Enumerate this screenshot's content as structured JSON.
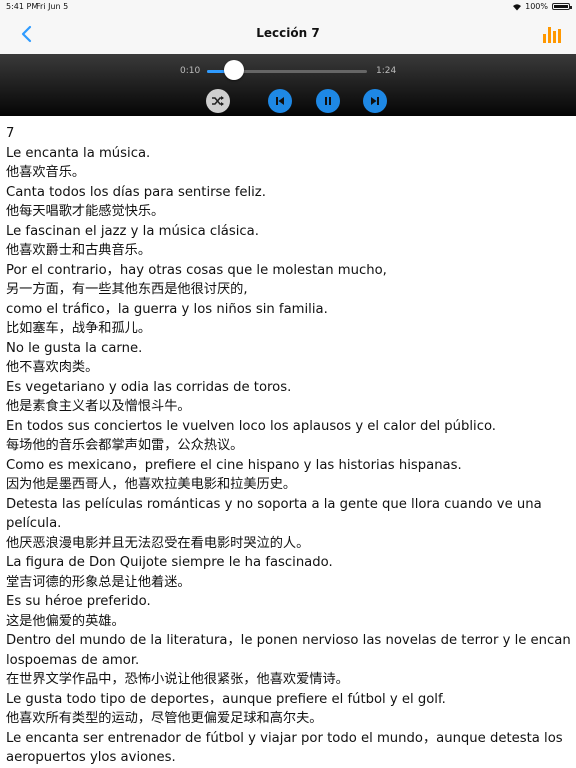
{
  "status_bar": {
    "time": "5:41 PM",
    "date": "Fri Jun 5",
    "battery": "100%",
    "battery_level": 1.0
  },
  "nav": {
    "title": "Lección 7",
    "back_icon": "chevron-left-icon",
    "stats_icon": "bar-chart-icon",
    "accent": "#2f9bff",
    "stats_color": "#ff9800"
  },
  "player": {
    "current_time": "0:10",
    "total_time": "1:24",
    "progress_fraction": 0.12,
    "controls": [
      "shuffle-icon",
      "skip-back-icon",
      "pause-icon",
      "skip-forward-icon"
    ]
  },
  "lines": [
    "7",
    "Le encanta la música.",
    "他喜欢音乐。",
    "Canta todos los días para sentirse feliz.",
    "他每天唱歌才能感觉快乐。",
    "Le fascinan el jazz y la música clásica.",
    "他喜欢爵士和古典音乐。",
    "Por el contrario，hay otras cosas que le molestan mucho,",
    "另一方面，有一些其他东西是他很讨厌的,",
    "como el tráfico，la guerra y los niños sin familia.",
    "比如塞车，战争和孤儿。",
    "No le gusta la carne.",
    "他不喜欢肉类。",
    "Es vegetariano y odia las corridas de toros.",
    "他是素食主义者以及憎恨斗牛。",
    "En todos sus conciertos le vuelven loco los aplausos y el calor del público.",
    "每场他的音乐会都掌声如雷，公众热议。",
    "Como es mexicano，prefiere el cine hispano y las historias hispanas.",
    "因为他是墨西哥人，他喜欢拉美电影和拉美历史。",
    "Detesta las películas románticas y no soporta a la gente que llora cuando ve una",
    "película.",
    "他厌恶浪漫电影并且无法忍受在看电影时哭泣的人。",
    "La figura de Don Quijote siempre le ha fascinado.",
    "堂吉诃德的形象总是让他着迷。",
    "Es su héroe preferido.",
    "这是他偏爱的英雄。",
    "Dentro del mundo de la literatura，le ponen nervioso las novelas de terror y le encantan",
    "lospoemas de amor.",
    "在世界文学作品中，恐怖小说让他很紧张，他喜欢爱情诗。",
    "Le gusta todo tipo de deportes，aunque prefiere el fútbol y el golf.",
    "他喜欢所有类型的运动，尽管他更偏爱足球和高尔夫。",
    "Le encanta ser entrenador de fútbol y viajar por todo el mundo，aunque detesta los",
    "aeropuertos ylos aviones."
  ]
}
